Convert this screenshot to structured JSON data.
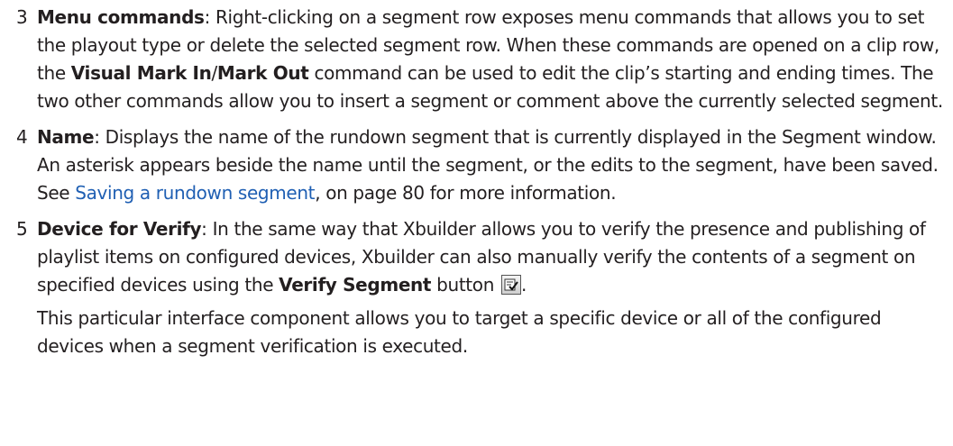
{
  "items": [
    {
      "number": "3",
      "term": "Menu commands",
      "t1": ": Right-clicking on a segment row exposes menu commands that allows you to set the playout type or delete the selected segment row. When these commands are opened on a clip row, the ",
      "bold1": "Visual Mark In",
      "slash": "/",
      "bold2": "Mark Out",
      "t2": " command can be used to edit the clip’s starting and ending times. The two other commands allow you to insert a segment or comment above the currently selected segment."
    },
    {
      "number": "4",
      "term": "Name",
      "t1": ": Displays the name of the rundown segment that is currently displayed in the Segment window. An asterisk appears beside the name until the segment, or the edits to the segment, have been saved. See ",
      "link": "Saving a rundown segment",
      "t2": ", on page 80 for more information."
    },
    {
      "number": "5",
      "term": "Device for Verify",
      "t1": ": In the same way that Xbuilder allows you to verify the presence and publishing of playlist items on configured devices, Xbuilder can also manually verify the contents of a segment on specified devices using the ",
      "bold1": "Verify Segment",
      "t2": " button ",
      "t3": ".",
      "para2": "This particular interface component allows you to target a specific device or all of the configured devices when a segment verification is executed."
    }
  ]
}
